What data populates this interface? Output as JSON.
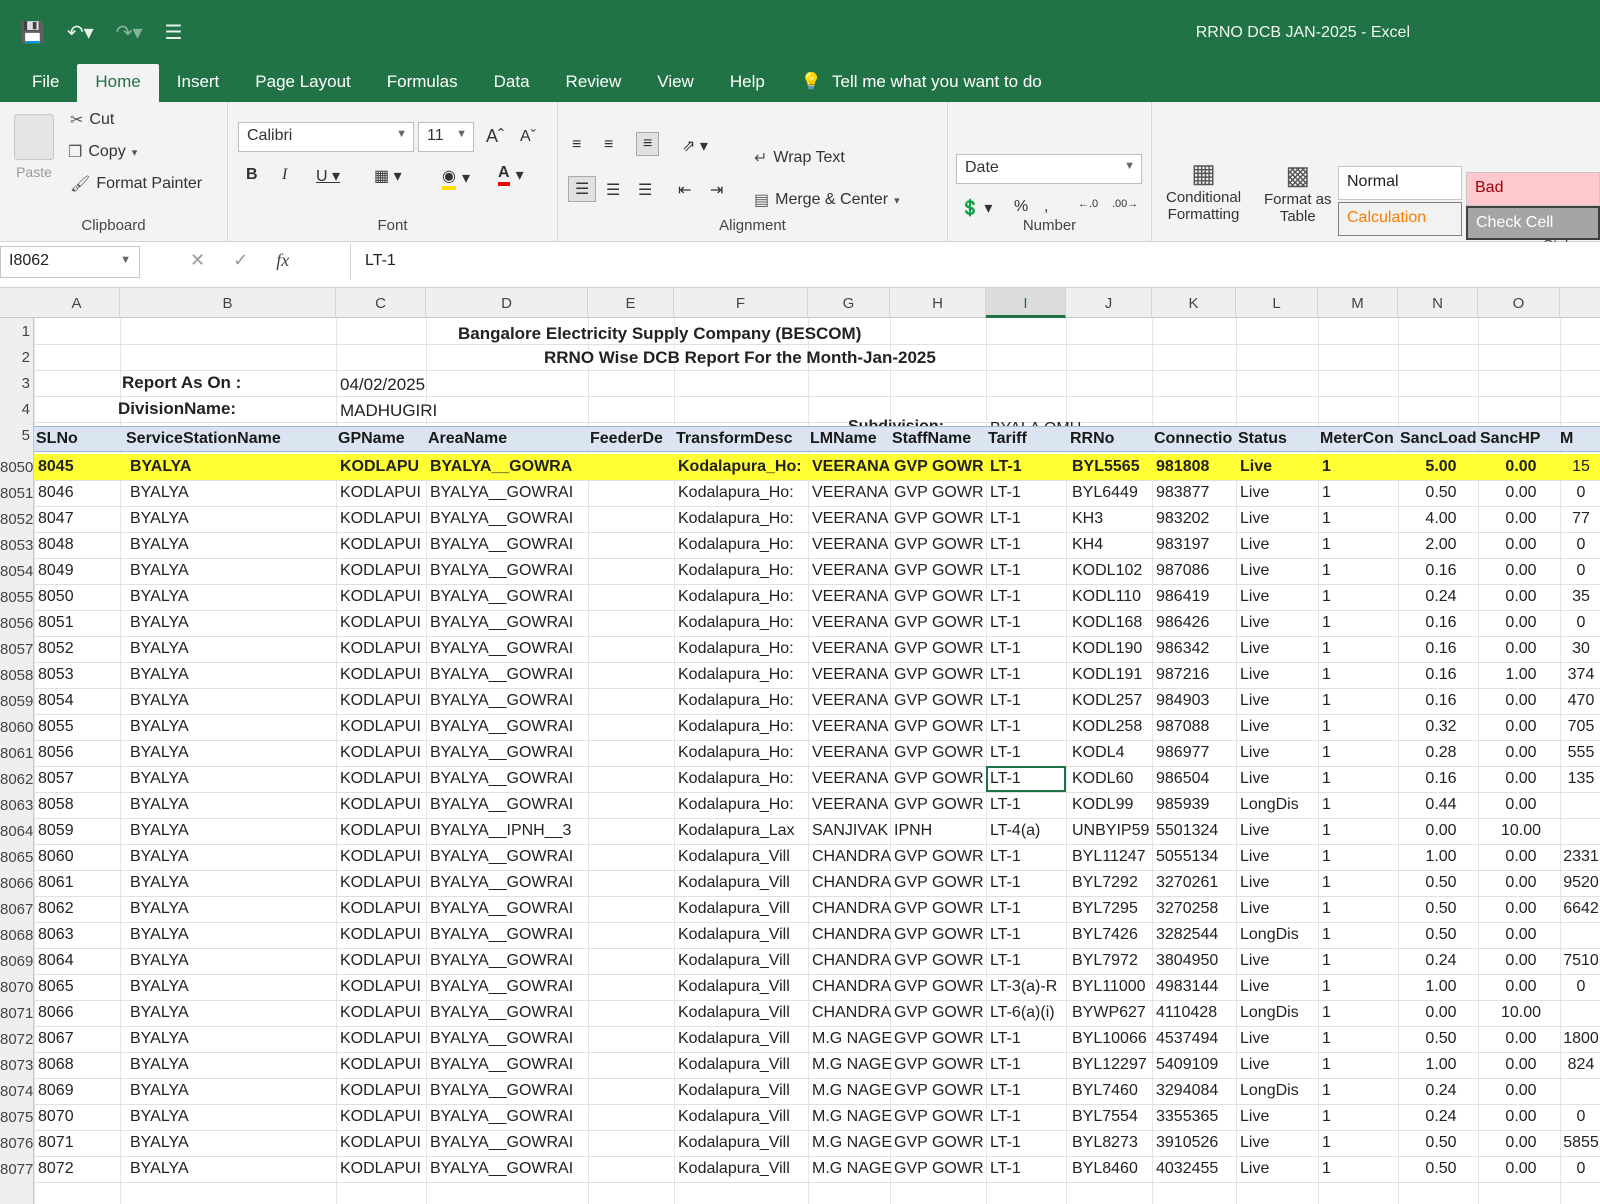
{
  "window": {
    "title": "RRNO DCB JAN-2025  -  Excel"
  },
  "tabs": [
    "File",
    "Home",
    "Insert",
    "Page Layout",
    "Formulas",
    "Data",
    "Review",
    "View",
    "Help"
  ],
  "tellme": "Tell me what you want to do",
  "ribbon": {
    "clipboard": {
      "paste": "Paste",
      "cut": "Cut",
      "copy": "Copy",
      "format_painter": "Format Painter",
      "label": "Clipboard"
    },
    "font": {
      "name": "Calibri",
      "size": "11",
      "label": "Font"
    },
    "alignment": {
      "wrap": "Wrap Text",
      "merge": "Merge & Center",
      "label": "Alignment"
    },
    "number": {
      "format": "Date",
      "label": "Number"
    },
    "styles": {
      "conditional": "Conditional",
      "conditional2": "Formatting",
      "format_as": "Format as",
      "format_as2": "Table",
      "normal": "Normal",
      "bad": "Bad",
      "calculation": "Calculation",
      "check": "Check Cell",
      "label": "Styles"
    }
  },
  "formula_bar": {
    "name_box": "I8062",
    "value": "LT-1"
  },
  "columns": [
    "A",
    "B",
    "C",
    "D",
    "E",
    "F",
    "G",
    "H",
    "I",
    "J",
    "K",
    "L",
    "M",
    "N",
    "O"
  ],
  "sheet": {
    "company": "Bangalore Electricity Supply Company (BESCOM)",
    "report_title": "RRNO Wise DCB Report For the Month-Jan-2025",
    "report_as_on_label": "Report As On :",
    "report_as_on_value": "04/02/2025",
    "division_label": "DivisionName:",
    "division_value": "MADHUGIRI",
    "subdivision_label": "Subdivision:",
    "subdivision_value": "BYALA OMU",
    "headers": [
      "SLNo",
      "ServiceStationName",
      "GPName",
      "AreaName",
      "FeederDe",
      "TransformDesc",
      "LMName",
      "StaffName",
      "Tariff",
      "RRNo",
      "Connectio",
      "Status",
      "MeterCon",
      "SancLoad",
      "SancHP",
      "M"
    ],
    "rows": [
      {
        "r": "8050",
        "sl": "8045",
        "ss": "BYALYA",
        "gp": "KODLAPU",
        "area": "BYALYA__GOWRA",
        "tr": "Kodalapura_Ho:",
        "lm": "VEERANA",
        "staff": "GVP GOWR",
        "tariff": "LT-1",
        "rrno": "BYL5565",
        "conn": "981808",
        "status": "Live",
        "mc": "1",
        "sl2": "5.00",
        "hp": "0.00",
        "m": "15"
      },
      {
        "r": "8051",
        "sl": "8046",
        "ss": "BYALYA",
        "gp": "KODLAPUI",
        "area": "BYALYA__GOWRAI",
        "tr": "Kodalapura_Ho:",
        "lm": "VEERANA",
        "staff": "GVP GOWR",
        "tariff": "LT-1",
        "rrno": "BYL6449",
        "conn": "983877",
        "status": "Live",
        "mc": "1",
        "sl2": "0.50",
        "hp": "0.00",
        "m": "0"
      },
      {
        "r": "8052",
        "sl": "8047",
        "ss": "BYALYA",
        "gp": "KODLAPUI",
        "area": "BYALYA__GOWRAI",
        "tr": "Kodalapura_Ho:",
        "lm": "VEERANA",
        "staff": "GVP GOWR",
        "tariff": "LT-1",
        "rrno": "KH3",
        "conn": "983202",
        "status": "Live",
        "mc": "1",
        "sl2": "4.00",
        "hp": "0.00",
        "m": "77"
      },
      {
        "r": "8053",
        "sl": "8048",
        "ss": "BYALYA",
        "gp": "KODLAPUI",
        "area": "BYALYA__GOWRAI",
        "tr": "Kodalapura_Ho:",
        "lm": "VEERANA",
        "staff": "GVP GOWR",
        "tariff": "LT-1",
        "rrno": "KH4",
        "conn": "983197",
        "status": "Live",
        "mc": "1",
        "sl2": "2.00",
        "hp": "0.00",
        "m": "0"
      },
      {
        "r": "8054",
        "sl": "8049",
        "ss": "BYALYA",
        "gp": "KODLAPUI",
        "area": "BYALYA__GOWRAI",
        "tr": "Kodalapura_Ho:",
        "lm": "VEERANA",
        "staff": "GVP GOWR",
        "tariff": "LT-1",
        "rrno": "KODL102",
        "conn": "987086",
        "status": "Live",
        "mc": "1",
        "sl2": "0.16",
        "hp": "0.00",
        "m": "0"
      },
      {
        "r": "8055",
        "sl": "8050",
        "ss": "BYALYA",
        "gp": "KODLAPUI",
        "area": "BYALYA__GOWRAI",
        "tr": "Kodalapura_Ho:",
        "lm": "VEERANA",
        "staff": "GVP GOWR",
        "tariff": "LT-1",
        "rrno": "KODL110",
        "conn": "986419",
        "status": "Live",
        "mc": "1",
        "sl2": "0.24",
        "hp": "0.00",
        "m": "35"
      },
      {
        "r": "8056",
        "sl": "8051",
        "ss": "BYALYA",
        "gp": "KODLAPUI",
        "area": "BYALYA__GOWRAI",
        "tr": "Kodalapura_Ho:",
        "lm": "VEERANA",
        "staff": "GVP GOWR",
        "tariff": "LT-1",
        "rrno": "KODL168",
        "conn": "986426",
        "status": "Live",
        "mc": "1",
        "sl2": "0.16",
        "hp": "0.00",
        "m": "0"
      },
      {
        "r": "8057",
        "sl": "8052",
        "ss": "BYALYA",
        "gp": "KODLAPUI",
        "area": "BYALYA__GOWRAI",
        "tr": "Kodalapura_Ho:",
        "lm": "VEERANA",
        "staff": "GVP GOWR",
        "tariff": "LT-1",
        "rrno": "KODL190",
        "conn": "986342",
        "status": "Live",
        "mc": "1",
        "sl2": "0.16",
        "hp": "0.00",
        "m": "30"
      },
      {
        "r": "8058",
        "sl": "8053",
        "ss": "BYALYA",
        "gp": "KODLAPUI",
        "area": "BYALYA__GOWRAI",
        "tr": "Kodalapura_Ho:",
        "lm": "VEERANA",
        "staff": "GVP GOWR",
        "tariff": "LT-1",
        "rrno": "KODL191",
        "conn": "987216",
        "status": "Live",
        "mc": "1",
        "sl2": "0.16",
        "hp": "1.00",
        "m": "374"
      },
      {
        "r": "8059",
        "sl": "8054",
        "ss": "BYALYA",
        "gp": "KODLAPUI",
        "area": "BYALYA__GOWRAI",
        "tr": "Kodalapura_Ho:",
        "lm": "VEERANA",
        "staff": "GVP GOWR",
        "tariff": "LT-1",
        "rrno": "KODL257",
        "conn": "984903",
        "status": "Live",
        "mc": "1",
        "sl2": "0.16",
        "hp": "0.00",
        "m": "470"
      },
      {
        "r": "8060",
        "sl": "8055",
        "ss": "BYALYA",
        "gp": "KODLAPUI",
        "area": "BYALYA__GOWRAI",
        "tr": "Kodalapura_Ho:",
        "lm": "VEERANA",
        "staff": "GVP GOWR",
        "tariff": "LT-1",
        "rrno": "KODL258",
        "conn": "987088",
        "status": "Live",
        "mc": "1",
        "sl2": "0.32",
        "hp": "0.00",
        "m": "705"
      },
      {
        "r": "8061",
        "sl": "8056",
        "ss": "BYALYA",
        "gp": "KODLAPUI",
        "area": "BYALYA__GOWRAI",
        "tr": "Kodalapura_Ho:",
        "lm": "VEERANA",
        "staff": "GVP GOWR",
        "tariff": "LT-1",
        "rrno": "KODL4",
        "conn": "986977",
        "status": "Live",
        "mc": "1",
        "sl2": "0.28",
        "hp": "0.00",
        "m": "555"
      },
      {
        "r": "8062",
        "sl": "8057",
        "ss": "BYALYA",
        "gp": "KODLAPUI",
        "area": "BYALYA__GOWRAI",
        "tr": "Kodalapura_Ho:",
        "lm": "VEERANA",
        "staff": "GVP GOWR",
        "tariff": "LT-1",
        "rrno": "KODL60",
        "conn": "986504",
        "status": "Live",
        "mc": "1",
        "sl2": "0.16",
        "hp": "0.00",
        "m": "135"
      },
      {
        "r": "8063",
        "sl": "8058",
        "ss": "BYALYA",
        "gp": "KODLAPUI",
        "area": "BYALYA__GOWRAI",
        "tr": "Kodalapura_Ho:",
        "lm": "VEERANA",
        "staff": "GVP GOWR",
        "tariff": "LT-1",
        "rrno": "KODL99",
        "conn": "985939",
        "status": "LongDis",
        "mc": "1",
        "sl2": "0.44",
        "hp": "0.00",
        "m": ""
      },
      {
        "r": "8064",
        "sl": "8059",
        "ss": "BYALYA",
        "gp": "KODLAPUI",
        "area": "BYALYA__IPNH__3",
        "tr": "Kodalapura_Lax",
        "lm": "SANJIVAK",
        "staff": "IPNH",
        "tariff": "LT-4(a)",
        "rrno": "UNBYIP59",
        "conn": "5501324",
        "status": "Live",
        "mc": "1",
        "sl2": "0.00",
        "hp": "10.00",
        "m": ""
      },
      {
        "r": "8065",
        "sl": "8060",
        "ss": "BYALYA",
        "gp": "KODLAPUI",
        "area": "BYALYA__GOWRAI",
        "tr": "Kodalapura_Vill",
        "lm": "CHANDRA",
        "staff": "GVP GOWR",
        "tariff": "LT-1",
        "rrno": "BYL11247",
        "conn": "5055134",
        "status": "Live",
        "mc": "1",
        "sl2": "1.00",
        "hp": "0.00",
        "m": "2331"
      },
      {
        "r": "8066",
        "sl": "8061",
        "ss": "BYALYA",
        "gp": "KODLAPUI",
        "area": "BYALYA__GOWRAI",
        "tr": "Kodalapura_Vill",
        "lm": "CHANDRA",
        "staff": "GVP GOWR",
        "tariff": "LT-1",
        "rrno": "BYL7292",
        "conn": "3270261",
        "status": "Live",
        "mc": "1",
        "sl2": "0.50",
        "hp": "0.00",
        "m": "9520"
      },
      {
        "r": "8067",
        "sl": "8062",
        "ss": "BYALYA",
        "gp": "KODLAPUI",
        "area": "BYALYA__GOWRAI",
        "tr": "Kodalapura_Vill",
        "lm": "CHANDRA",
        "staff": "GVP GOWR",
        "tariff": "LT-1",
        "rrno": "BYL7295",
        "conn": "3270258",
        "status": "Live",
        "mc": "1",
        "sl2": "0.50",
        "hp": "0.00",
        "m": "6642"
      },
      {
        "r": "8068",
        "sl": "8063",
        "ss": "BYALYA",
        "gp": "KODLAPUI",
        "area": "BYALYA__GOWRAI",
        "tr": "Kodalapura_Vill",
        "lm": "CHANDRA",
        "staff": "GVP GOWR",
        "tariff": "LT-1",
        "rrno": "BYL7426",
        "conn": "3282544",
        "status": "LongDis",
        "mc": "1",
        "sl2": "0.50",
        "hp": "0.00",
        "m": ""
      },
      {
        "r": "8069",
        "sl": "8064",
        "ss": "BYALYA",
        "gp": "KODLAPUI",
        "area": "BYALYA__GOWRAI",
        "tr": "Kodalapura_Vill",
        "lm": "CHANDRA",
        "staff": "GVP GOWR",
        "tariff": "LT-1",
        "rrno": "BYL7972",
        "conn": "3804950",
        "status": "Live",
        "mc": "1",
        "sl2": "0.24",
        "hp": "0.00",
        "m": "7510"
      },
      {
        "r": "8070",
        "sl": "8065",
        "ss": "BYALYA",
        "gp": "KODLAPUI",
        "area": "BYALYA__GOWRAI",
        "tr": "Kodalapura_Vill",
        "lm": "CHANDRA",
        "staff": "GVP GOWR",
        "tariff": "LT-3(a)-R",
        "rrno": "BYL11000",
        "conn": "4983144",
        "status": "Live",
        "mc": "1",
        "sl2": "1.00",
        "hp": "0.00",
        "m": "0"
      },
      {
        "r": "8071",
        "sl": "8066",
        "ss": "BYALYA",
        "gp": "KODLAPUI",
        "area": "BYALYA__GOWRAI",
        "tr": "Kodalapura_Vill",
        "lm": "CHANDRA",
        "staff": "GVP GOWR",
        "tariff": "LT-6(a)(i)",
        "rrno": "BYWP627",
        "conn": "4110428",
        "status": "LongDis",
        "mc": "1",
        "sl2": "0.00",
        "hp": "10.00",
        "m": ""
      },
      {
        "r": "8072",
        "sl": "8067",
        "ss": "BYALYA",
        "gp": "KODLAPUI",
        "area": "BYALYA__GOWRAI",
        "tr": "Kodalapura_Vill",
        "lm": "M.G NAGE",
        "staff": "GVP GOWR",
        "tariff": "LT-1",
        "rrno": "BYL10066",
        "conn": "4537494",
        "status": "Live",
        "mc": "1",
        "sl2": "0.50",
        "hp": "0.00",
        "m": "1800"
      },
      {
        "r": "8073",
        "sl": "8068",
        "ss": "BYALYA",
        "gp": "KODLAPUI",
        "area": "BYALYA__GOWRAI",
        "tr": "Kodalapura_Vill",
        "lm": "M.G NAGE",
        "staff": "GVP GOWR",
        "tariff": "LT-1",
        "rrno": "BYL12297",
        "conn": "5409109",
        "status": "Live",
        "mc": "1",
        "sl2": "1.00",
        "hp": "0.00",
        "m": "824"
      },
      {
        "r": "8074",
        "sl": "8069",
        "ss": "BYALYA",
        "gp": "KODLAPUI",
        "area": "BYALYA__GOWRAI",
        "tr": "Kodalapura_Vill",
        "lm": "M.G NAGE",
        "staff": "GVP GOWR",
        "tariff": "LT-1",
        "rrno": "BYL7460",
        "conn": "3294084",
        "status": "LongDis",
        "mc": "1",
        "sl2": "0.24",
        "hp": "0.00",
        "m": ""
      },
      {
        "r": "8075",
        "sl": "8070",
        "ss": "BYALYA",
        "gp": "KODLAPUI",
        "area": "BYALYA__GOWRAI",
        "tr": "Kodalapura_Vill",
        "lm": "M.G NAGE",
        "staff": "GVP GOWR",
        "tariff": "LT-1",
        "rrno": "BYL7554",
        "conn": "3355365",
        "status": "Live",
        "mc": "1",
        "sl2": "0.24",
        "hp": "0.00",
        "m": "0"
      },
      {
        "r": "8076",
        "sl": "8071",
        "ss": "BYALYA",
        "gp": "KODLAPUI",
        "area": "BYALYA__GOWRAI",
        "tr": "Kodalapura_Vill",
        "lm": "M.G NAGE",
        "staff": "GVP GOWR",
        "tariff": "LT-1",
        "rrno": "BYL8273",
        "conn": "3910526",
        "status": "Live",
        "mc": "1",
        "sl2": "0.50",
        "hp": "0.00",
        "m": "5855"
      },
      {
        "r": "8077",
        "sl": "8072",
        "ss": "BYALYA",
        "gp": "KODLAPUI",
        "area": "BYALYA__GOWRAI",
        "tr": "Kodalapura_Vill",
        "lm": "M.G NAGE",
        "staff": "GVP GOWR",
        "tariff": "LT-1",
        "rrno": "BYL8460",
        "conn": "4032455",
        "status": "Live",
        "mc": "1",
        "sl2": "0.50",
        "hp": "0.00",
        "m": "0"
      }
    ]
  },
  "colors": {
    "excel_green": "#217346",
    "highlight": "#ffff33",
    "header_fill": "#dbe5f1"
  }
}
